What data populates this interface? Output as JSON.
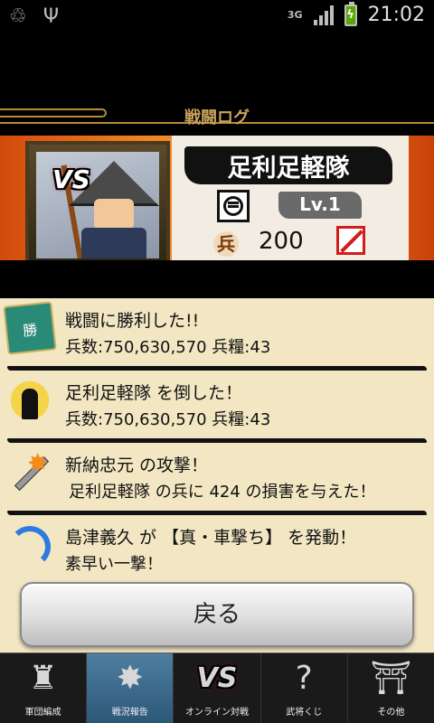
{
  "status_bar": {
    "left_icons": [
      "recycle-icon",
      "usb-icon"
    ],
    "network": "3G",
    "signal_bars": 4,
    "time": "21:02",
    "colors": {
      "battery_fill": "#59a800"
    }
  },
  "header": {
    "title": "戦闘ログ"
  },
  "enemy": {
    "vs_badge": "VS",
    "name": "足利足軽隊",
    "level": "Lv.1",
    "troop_glyph": "兵",
    "troops": "200"
  },
  "log": {
    "entries": [
      {
        "icon": "victory-flag-icon",
        "icon_text": "勝",
        "line_a": "戦闘に勝利した!!",
        "line_b": "兵数:750,630,570 兵糧:43"
      },
      {
        "icon": "defeat-icon",
        "line_a": "足利足軽隊 を倒した！",
        "line_b": "兵数:750,630,570 兵糧:43"
      },
      {
        "icon": "attack-icon",
        "line_a": "新納忠元 の攻撃！",
        "line_b": "足利足軽隊 の兵に 424 の損害を与えた！"
      },
      {
        "icon": "skill-icon",
        "line_a": "島津義久 が 【真・車撃ち】 を発動！",
        "line_b": "素早い一撃！"
      }
    ]
  },
  "back_button": {
    "label": "戻る"
  },
  "nav": {
    "items": [
      {
        "label": "軍団編成",
        "icon": "samurai-helmet-icon",
        "glyph": "♜",
        "active": false
      },
      {
        "label": "戦況報告",
        "icon": "spear-icon",
        "glyph": "✸",
        "active": true
      },
      {
        "label": "オンライン対戦",
        "icon": "vs-icon",
        "glyph": "VS",
        "active": false
      },
      {
        "label": "武将くじ",
        "icon": "question-icon",
        "glyph": "?",
        "active": false
      },
      {
        "label": "その他",
        "icon": "gate-icon",
        "glyph": "⛩",
        "active": false
      }
    ]
  }
}
